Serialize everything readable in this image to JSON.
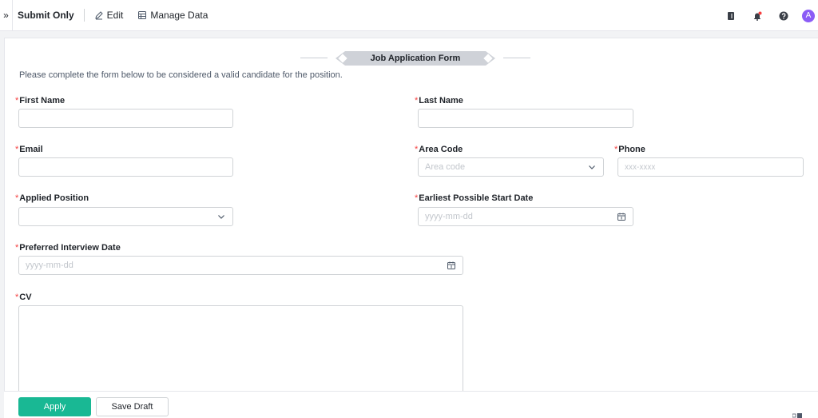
{
  "toolbar": {
    "collapse_glyph": "»",
    "submit_only": "Submit Only",
    "edit": "Edit",
    "manage_data": "Manage Data",
    "avatar_initial": "A"
  },
  "form": {
    "title": "Job Application Form",
    "intro": "Please complete the form below to be considered a valid candidate for the position.",
    "required_mark": "*",
    "fields": {
      "first_name": {
        "label": "First Name",
        "value": ""
      },
      "last_name": {
        "label": "Last Name",
        "value": ""
      },
      "email": {
        "label": "Email",
        "value": ""
      },
      "area_code": {
        "label": "Area Code",
        "placeholder": "Area code"
      },
      "phone": {
        "label": "Phone",
        "placeholder": "xxx-xxxx"
      },
      "applied_position": {
        "label": "Applied Position",
        "value": ""
      },
      "earliest_start": {
        "label": "Earliest Possible Start Date",
        "placeholder": "yyyy-mm-dd"
      },
      "interview_date": {
        "label": "Preferred Interview Date",
        "placeholder": "yyyy-mm-dd"
      },
      "cv": {
        "label": "CV",
        "value": ""
      }
    }
  },
  "footer": {
    "apply": "Apply",
    "save_draft": "Save Draft"
  },
  "icons": {
    "collapse": "double-chevron-right-icon",
    "edit": "pencil-icon",
    "manage": "table-icon",
    "book": "book-icon",
    "bell": "bell-icon",
    "help": "question-icon",
    "dropdown": "chevron-down-icon",
    "calendar": "calendar-icon"
  },
  "colors": {
    "accent": "#19b894",
    "required": "#f53f3f",
    "avatar": "#8b5cf6",
    "notification_dot": "#f53f3f"
  }
}
